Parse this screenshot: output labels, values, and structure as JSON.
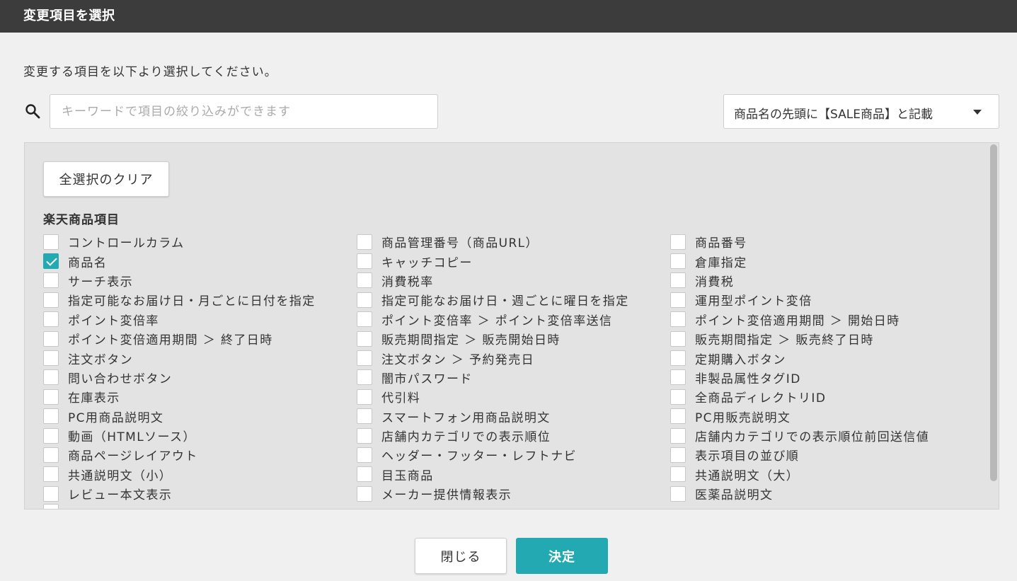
{
  "dialog": {
    "title": "変更項目を選択",
    "instruction": "変更する項目を以下より選択してください。"
  },
  "search": {
    "placeholder": "キーワードで項目の絞り込みができます",
    "value": "",
    "icon": "search-icon"
  },
  "dropdown": {
    "selected": "商品名の先頭に【SALE商品】と記載",
    "icon": "chevron-down-icon"
  },
  "panel": {
    "clear_button": "全選択のクリア",
    "section_title": "楽天商品項目",
    "accent_color": "#22a9b2",
    "columns": [
      [
        {
          "label": "コントロールカラム",
          "checked": false
        },
        {
          "label": "商品名",
          "checked": true
        },
        {
          "label": "サーチ表示",
          "checked": false
        },
        {
          "label": "指定可能なお届け日・月ごとに日付を指定",
          "checked": false
        },
        {
          "label": "ポイント変倍率",
          "checked": false
        },
        {
          "label": "ポイント変倍適用期間 ＞ 終了日時",
          "checked": false
        },
        {
          "label": "注文ボタン",
          "checked": false
        },
        {
          "label": "問い合わせボタン",
          "checked": false
        },
        {
          "label": "在庫表示",
          "checked": false
        },
        {
          "label": "PC用商品説明文",
          "checked": false
        },
        {
          "label": "動画（HTMLソース）",
          "checked": false
        },
        {
          "label": "商品ページレイアウト",
          "checked": false
        },
        {
          "label": "共通説明文（小）",
          "checked": false
        },
        {
          "label": "レビュー本文表示",
          "checked": false
        }
      ],
      [
        {
          "label": "商品管理番号（商品URL）",
          "checked": false
        },
        {
          "label": "キャッチコピー",
          "checked": false
        },
        {
          "label": "消費税率",
          "checked": false
        },
        {
          "label": "指定可能なお届け日・週ごとに曜日を指定",
          "checked": false
        },
        {
          "label": "ポイント変倍率 ＞ ポイント変倍率送信",
          "checked": false
        },
        {
          "label": "販売期間指定 ＞ 販売開始日時",
          "checked": false
        },
        {
          "label": "注文ボタン ＞ 予約発売日",
          "checked": false
        },
        {
          "label": "闇市パスワード",
          "checked": false
        },
        {
          "label": "代引料",
          "checked": false
        },
        {
          "label": "スマートフォン用商品説明文",
          "checked": false
        },
        {
          "label": "店舗内カテゴリでの表示順位",
          "checked": false
        },
        {
          "label": "ヘッダー・フッター・レフトナビ",
          "checked": false
        },
        {
          "label": "目玉商品",
          "checked": false
        },
        {
          "label": "メーカー提供情報表示",
          "checked": false
        }
      ],
      [
        {
          "label": "商品番号",
          "checked": false
        },
        {
          "label": "倉庫指定",
          "checked": false
        },
        {
          "label": "消費税",
          "checked": false
        },
        {
          "label": "運用型ポイント変倍",
          "checked": false
        },
        {
          "label": "ポイント変倍適用期間 ＞ 開始日時",
          "checked": false
        },
        {
          "label": "販売期間指定 ＞ 販売終了日時",
          "checked": false
        },
        {
          "label": "定期購入ボタン",
          "checked": false
        },
        {
          "label": "非製品属性タグID",
          "checked": false
        },
        {
          "label": "全商品ディレクトリID",
          "checked": false
        },
        {
          "label": "PC用販売説明文",
          "checked": false
        },
        {
          "label": "店舗内カテゴリでの表示順位前回送信値",
          "checked": false
        },
        {
          "label": "表示項目の並び順",
          "checked": false
        },
        {
          "label": "共通説明文（大）",
          "checked": false
        },
        {
          "label": "医薬品説明文",
          "checked": false
        }
      ]
    ]
  },
  "footer": {
    "close_label": "閉じる",
    "confirm_label": "決定"
  }
}
